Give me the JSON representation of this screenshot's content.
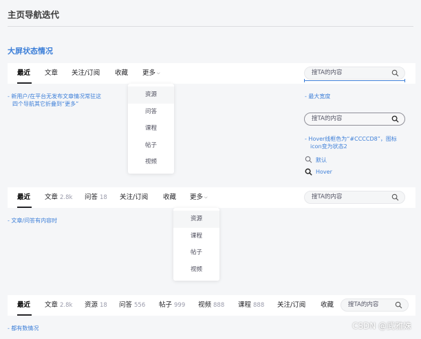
{
  "page_title": "主页导航迭代",
  "section_title": "大屏状态情况",
  "nav1": {
    "items": [
      "最近",
      "文章",
      "关注/订阅",
      "收藏"
    ],
    "more_label": "更多",
    "search_placeholder": "搜TA的内容",
    "dropdown": [
      "资源",
      "问答",
      "课程",
      "帖子",
      "视频"
    ]
  },
  "nav2": {
    "items": [
      {
        "label": "最近",
        "count": ""
      },
      {
        "label": "文章",
        "count": "2.8k"
      },
      {
        "label": "问答",
        "count": "18"
      },
      {
        "label": "关注/订阅",
        "count": ""
      },
      {
        "label": "收藏",
        "count": ""
      }
    ],
    "more_label": "更多",
    "search_placeholder": "搜TA的内容",
    "dropdown": [
      "资源",
      "课程",
      "帖子",
      "视频"
    ]
  },
  "nav3": {
    "items": [
      {
        "label": "最近",
        "count": ""
      },
      {
        "label": "文章",
        "count": "2.8k"
      },
      {
        "label": "资源",
        "count": "18"
      },
      {
        "label": "问答",
        "count": "556"
      },
      {
        "label": "帖子",
        "count": "999"
      },
      {
        "label": "视频",
        "count": "888"
      },
      {
        "label": "课程",
        "count": "888"
      },
      {
        "label": "关注/订阅",
        "count": ""
      },
      {
        "label": "收藏",
        "count": ""
      }
    ],
    "search_placeholder": "搜TA的内容"
  },
  "notes": {
    "new_user_line1": "- 新用户/在平台无发布文章情况常驻这",
    "new_user_line2": "四个导航其它折叠到“更多”",
    "max_width": "- 最大宽度",
    "hover_line1": "- Hover线框色为“#CCCCD8”，图标",
    "hover_line2": "icon变为状态2",
    "state_default": "默认",
    "state_hover": "Hover",
    "article_qa": "- 文章/问答有内容时",
    "all_data": "- 都有数情况"
  },
  "demo_search_placeholder": "搜TA的内容",
  "watermark": "CSDN @武雅姝",
  "colors": {
    "accent_blue": "#3d7fd8",
    "text_dark": "#222226",
    "hover_outline": "#CCCCD8"
  }
}
